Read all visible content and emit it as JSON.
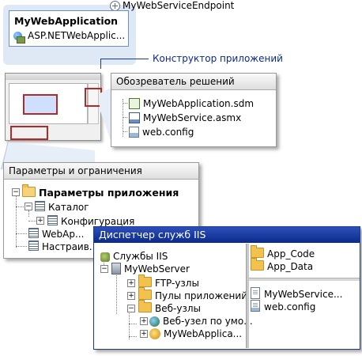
{
  "endpoint": {
    "label": "MyWebServiceEndpoint"
  },
  "app_box": {
    "title": "MyWebApplication",
    "subtitle": "ASP.NETWebApplic..."
  },
  "designer": {
    "label": "Конструктор приложений"
  },
  "solution_explorer": {
    "title": "Обозреватель решений",
    "items": [
      "MyWebApplication.sdm",
      "MyWebService.asmx",
      "web.config"
    ]
  },
  "settings": {
    "title": "Параметры и ограничения",
    "root": "Параметры приложения",
    "items": [
      "Каталог",
      "Конфигурация",
      "WebAp...",
      "Настраив..."
    ]
  },
  "iis": {
    "title": "Диспетчер служб IIS",
    "root": "Службы IIS",
    "server": "MyWebServer",
    "nodes": [
      "FTP-узлы",
      "Пулы приложений",
      "Веб-узлы"
    ],
    "sites": [
      "Веб-узел по умо...",
      "MyWebApplica..."
    ],
    "folders": [
      "App_Code",
      "App_Data"
    ],
    "files": [
      "MyWebService...",
      "web.config"
    ]
  },
  "colors": {
    "accent": "#0a2a8c",
    "highlight": "#b02a2a",
    "panel_light": "#dfe8f5"
  }
}
